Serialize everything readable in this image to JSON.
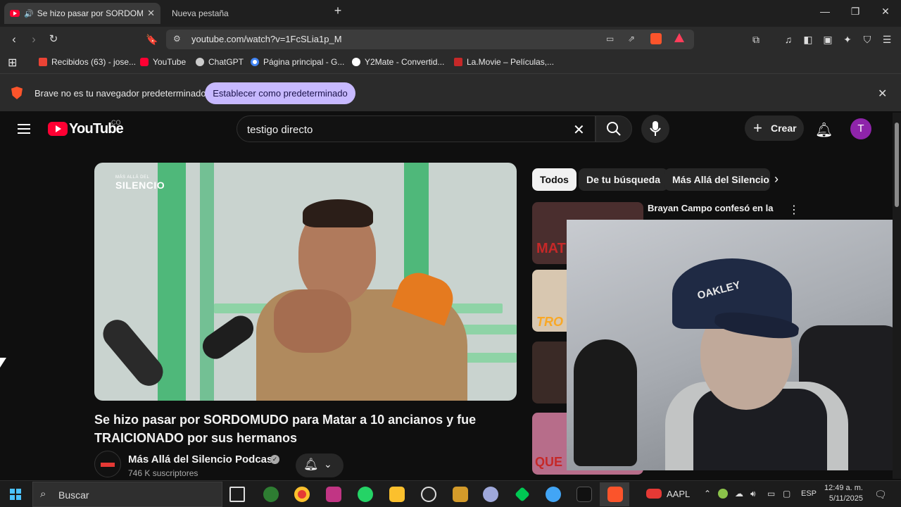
{
  "browser": {
    "tabs": [
      {
        "label": "Se hizo pasar por SORDOMUDO"
      },
      {
        "label": "Nueva pestaña"
      }
    ],
    "url": "youtube.com/watch?v=1FcSLia1p_M",
    "bookmarks": [
      {
        "label": "Recibidos (63) - jose..."
      },
      {
        "label": "YouTube"
      },
      {
        "label": "ChatGPT"
      },
      {
        "label": "Página principal - G..."
      },
      {
        "label": "Y2Mate - Convertid..."
      },
      {
        "label": "La.Movie – Películas,..."
      }
    ],
    "infobar": {
      "text": "Brave no es tu navegador predeterminado",
      "button": "Establecer como predeterminado"
    }
  },
  "youtube": {
    "logo_text": "YouTube",
    "country": "CO",
    "search_query": "testigo directo",
    "create_label": "Crear",
    "avatar_letter": "T",
    "video": {
      "watermark": "SILENCIO",
      "watermark_top": "MÁS ALLÁ DEL",
      "title": "Se hizo pasar por SORDOMUDO para Matar a 10 ancianos y fue TRAICIONADO por sus hermanos",
      "channel": "Más Allá del Silencio Podcast",
      "subscribers": "746 K suscriptores"
    },
    "chips": [
      "Todos",
      "De tu búsqueda",
      "Más Allá del Silencio Podcast"
    ],
    "recommendations": [
      {
        "title": "Brayan Campo confesó en la",
        "thumb_text": "MAT",
        "thumb_color": "#c62828"
      },
      {
        "title": "",
        "thumb_text": "TRO",
        "thumb_color": "#f9a825"
      },
      {
        "title": "",
        "thumb_text": "",
        "thumb_color": "#5d4037"
      },
      {
        "title": "",
        "thumb_text": "QUE",
        "thumb_color": "#c62828"
      }
    ],
    "webcam_logo": "OAKLEY"
  },
  "taskbar": {
    "search_placeholder": "Buscar",
    "stock": "AAPL",
    "lang": "ESP",
    "time": "12:49 a. m.",
    "date": "5/11/2025"
  }
}
